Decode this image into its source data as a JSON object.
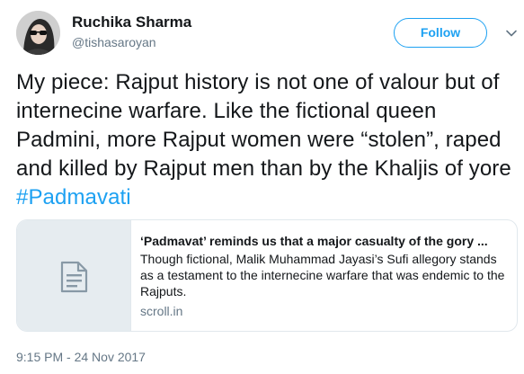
{
  "user": {
    "name": "Ruchika Sharma",
    "handle": "@tishasaroyan"
  },
  "actions": {
    "follow_label": "Follow",
    "menu_icon": "chevron-down-icon"
  },
  "tweet": {
    "text": "My piece: Rajput history is not one of valour but of internecine warfare. Like the fictional queen Padmini, more Rajput women were “stolen”, raped and killed by Rajput men than by the Khaljis of yore ",
    "hashtag": "#Padmavati",
    "timestamp": "9:15 PM - 24 Nov 2017"
  },
  "card": {
    "title": "‘Padmavat’ reminds us that a major casualty of the gory ...",
    "description": "Though fictional, Malik Muhammad Jayasi’s Sufi allegory stands as a testament to the internecine warfare that was endemic to the Rajputs.",
    "domain": "scroll.in",
    "thumb_icon": "document-icon"
  },
  "colors": {
    "accent": "#1da1f2",
    "text": "#14171a",
    "muted": "#657786",
    "border": "#e1e8ed",
    "thumb_bg": "#e6ecf0"
  }
}
